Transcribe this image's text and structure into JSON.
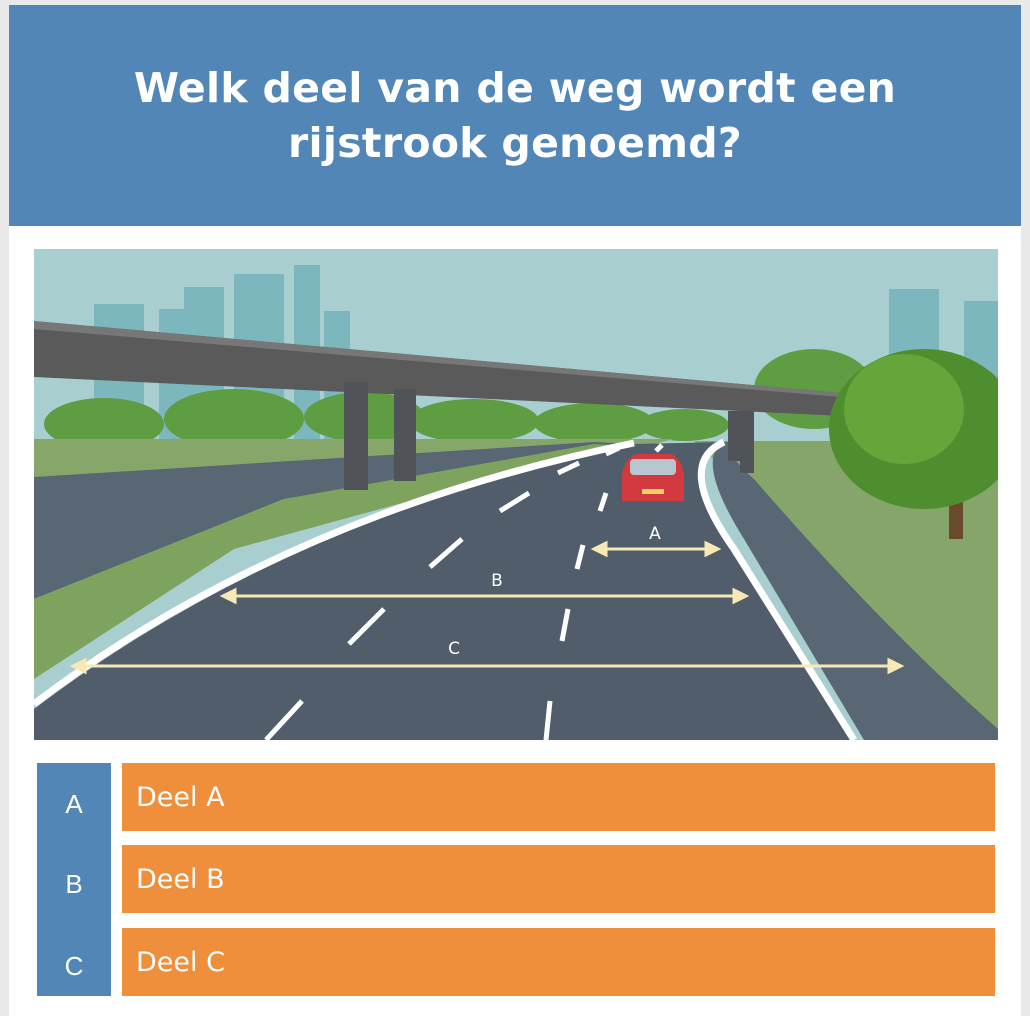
{
  "question": {
    "title": "Welk deel van de weg wordt een rijstrook genoemd?"
  },
  "illustration": {
    "labels": [
      "A",
      "B",
      "C"
    ]
  },
  "answers": [
    {
      "letter": "A",
      "label": "Deel A"
    },
    {
      "letter": "B",
      "label": "Deel B"
    },
    {
      "letter": "C",
      "label": "Deel C"
    }
  ],
  "colors": {
    "header": "#5286b7",
    "answer": "#ef8f3b",
    "letter_column": "#5286b7"
  }
}
